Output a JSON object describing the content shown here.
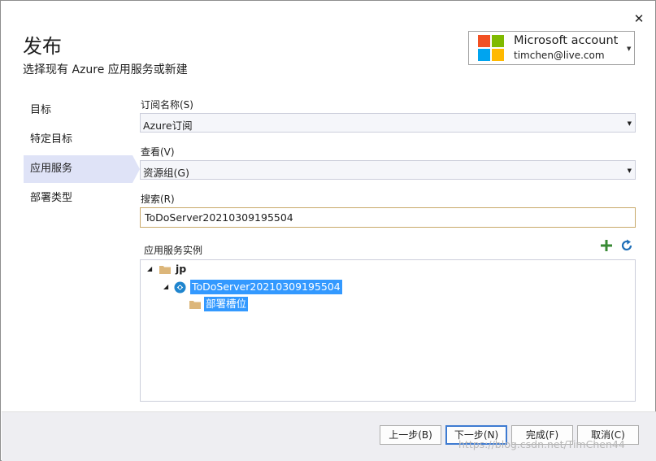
{
  "dialog": {
    "close_glyph": "✕",
    "title": "发布",
    "subtitle": "选择现有 Azure 应用服务或新建"
  },
  "account": {
    "name": "Microsoft account",
    "email": "timchen@live.com",
    "logo_colors": [
      "#f25022",
      "#7fba00",
      "#00a4ef",
      "#ffb900"
    ]
  },
  "nav": {
    "items": [
      {
        "label": "目标"
      },
      {
        "label": "特定目标"
      },
      {
        "label": "应用服务"
      },
      {
        "label": "部署类型"
      }
    ],
    "active_index": 2
  },
  "form": {
    "subscription_label": "订阅名称(S)",
    "subscription_value": "Azure订阅",
    "view_label": "查看(V)",
    "view_value": "资源组(G)",
    "search_label": "搜索(R)",
    "search_value": "ToDoServer20210309195504",
    "instances_label": "应用服务实例"
  },
  "tree": {
    "group": "jp",
    "app": "ToDoServer20210309195504",
    "slot": "部署槽位"
  },
  "footer": {
    "back_label": "上一步(B)",
    "next_label": "下一步(N)",
    "finish_label": "完成(F)",
    "cancel_label": "取消(C)",
    "watermark": "https://blog.csdn.net/TimChen44"
  },
  "colors": {
    "accent": "#3399ff",
    "nav_active": "#dfe3f7",
    "add_green": "#388a34",
    "refresh_blue": "#1e6fb8"
  }
}
